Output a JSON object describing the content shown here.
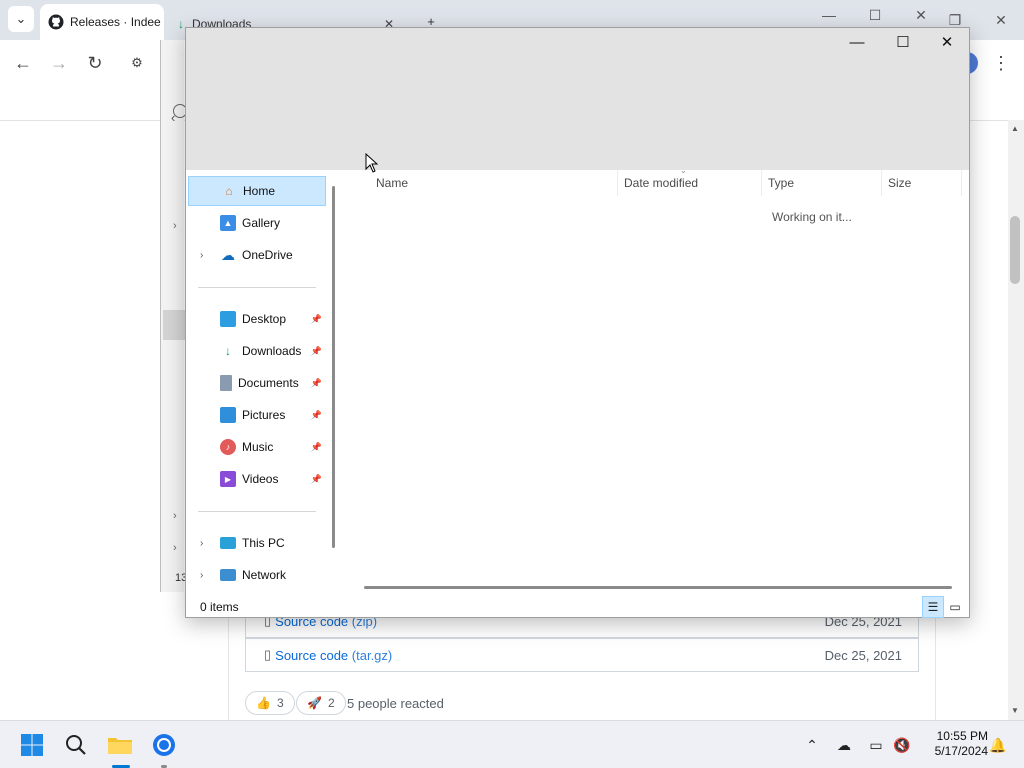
{
  "browser": {
    "tabs": [
      {
        "label": "Releases · Indee"
      },
      {
        "label": "Downloads"
      }
    ],
    "new_tab_label": "+",
    "page": {
      "assets": [
        {
          "name": "Source code",
          "ext": "(zip)",
          "date": "Dec 25, 2021"
        },
        {
          "name": "Source code",
          "ext": "(tar.gz)",
          "date": "Dec 25, 2021"
        }
      ],
      "reactions": [
        {
          "emoji": "👍",
          "count": "3"
        },
        {
          "emoji": "🚀",
          "count": "2"
        }
      ],
      "reactions_text": "5 people reacted",
      "left_counter": "13"
    }
  },
  "explorer": {
    "nav": {
      "home": "Home",
      "gallery": "Gallery",
      "onedrive": "OneDrive",
      "desktop": "Desktop",
      "downloads": "Downloads",
      "documents": "Documents",
      "pictures": "Pictures",
      "music": "Music",
      "videos": "Videos",
      "this_pc": "This PC",
      "network": "Network"
    },
    "columns": {
      "name": "Name",
      "date_modified": "Date modified",
      "type": "Type",
      "size": "Size"
    },
    "status_message": "Working on it...",
    "item_count": "0 items"
  },
  "taskbar": {
    "time": "10:55 PM",
    "date": "5/17/2024"
  },
  "colors": {
    "accent": "#0078d4",
    "selection_bg": "#cce8ff",
    "link": "#0969da"
  }
}
